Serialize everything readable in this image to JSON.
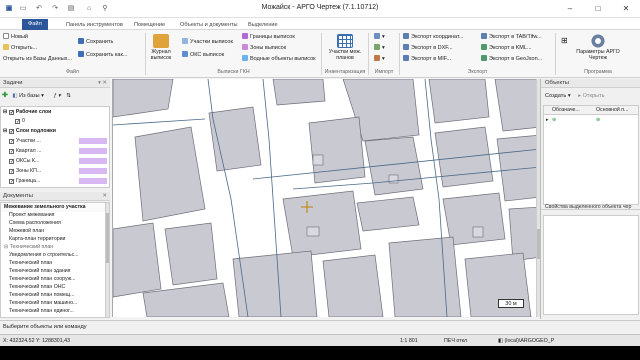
{
  "window": {
    "title": "Можайск - АРГО Чертеж (7.1.10712)",
    "controls": [
      "–",
      "□",
      "✕"
    ]
  },
  "tabs": [
    "Файл",
    "Панель инструментов",
    "Помещение",
    "Объекты и документы",
    "Выделение"
  ],
  "ribbon": {
    "file_group": {
      "items": [
        "Новый",
        "Открыть...",
        "Открыть из Базы Данных..."
      ],
      "save": "Сохранить",
      "save_as": "Сохранить как...",
      "label": "Файл"
    },
    "extract_group": {
      "big_button": "Журнал выписок",
      "items": [
        "Участки выписок",
        "ОКС выписок",
        "Границы выписок",
        "Зоны выписок",
        "Водные объекты выписок"
      ],
      "label": "Выписки ГКН"
    },
    "inventory_group": {
      "big_button": "Участки меж. планов",
      "label": "Инвентаризация"
    },
    "import_group": {
      "label": "Импорт"
    },
    "export_group": {
      "items": [
        "Экспорт координат...",
        "Экспорт в DXF...",
        "Экспорт в MIF...",
        "Экспорт в TAB/Tifw...",
        "Экспорт в KML...",
        "Экспорт в GeoJson..."
      ],
      "label": "Экспорт"
    },
    "program_group": {
      "big_button": "Параметры АРГО Чертеж",
      "label": "Программа"
    }
  },
  "left_panel": {
    "tasks_title": "Задачи",
    "from_db": "Из базы",
    "layers_root": "Рабочие слои",
    "layer_zero": "0",
    "underlay_root": "Слои подложки",
    "underlays": [
      "Участки ...",
      "Квартал ...",
      "ОКСы К...",
      "Зоны КП...",
      "Граница..."
    ],
    "documents_title": "Документы",
    "doc_head": "Межевание земельного участка",
    "docs": [
      "Проект межевания",
      "Схема расположения",
      "Межевой план",
      "Карта-план территории"
    ],
    "tech_head": "Технический план",
    "tech_docs": [
      "Уведомления о строительс...",
      "Технический план",
      "Технический план здания",
      "Технический план сооруж...",
      "Технический план ОНС",
      "Технический план помещ...",
      "Технический план машино...",
      "Технический план единог..."
    ]
  },
  "right_panel": {
    "objects_title": "Объекты",
    "create": "Создать",
    "open": "Открыть",
    "col1": "Обозначе...",
    "col2": "Основной п...",
    "props_title": "Свойства выделенного объекта чер"
  },
  "map": {
    "scale_label": "30 м"
  },
  "status": {
    "hint": "Выберите объекты или команду",
    "coords": "X: 432324,52 Y: 1288301,43",
    "scale": "1:1 801",
    "mode": "ПЕЧ откл",
    "db": "(local)\\ARGOGEO_P"
  },
  "colors": {
    "accent": "#2b579a",
    "building_fill": "#c9c9d1",
    "parcel_line": "#4a6a8a",
    "underlay_swatch": "#d7b8f3",
    "cursor": "#c08000"
  }
}
